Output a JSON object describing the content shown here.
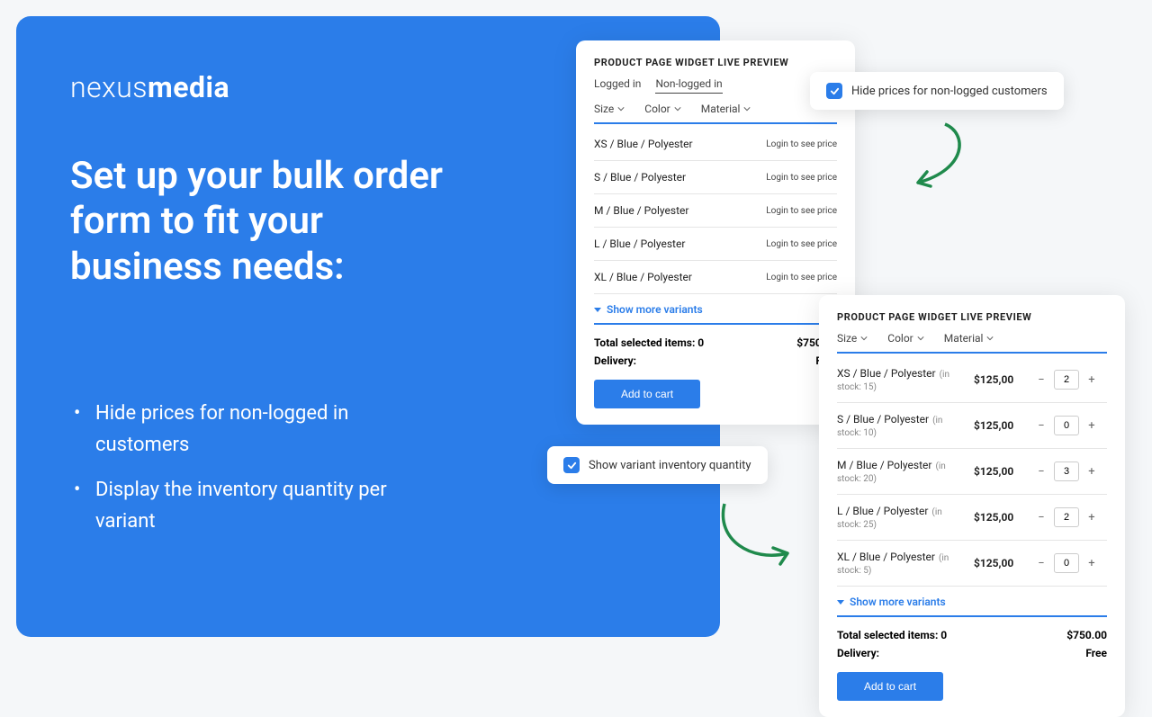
{
  "logo": {
    "part1": "nexus",
    "part2": "media"
  },
  "headline": "Set up your bulk order form to fit your business needs:",
  "bullets": [
    "Hide prices for non-logged in customers",
    "Display the inventory quantity per variant"
  ],
  "toggles": {
    "hide_prices": "Hide prices for non-logged customers",
    "show_inventory": "Show variant inventory quantity"
  },
  "widget_title": "PRODUCT PAGE WIDGET LIVE PREVIEW",
  "tabs": {
    "logged_in": "Logged in",
    "non_logged": "Non-logged in"
  },
  "filters": {
    "size": "Size",
    "color": "Color",
    "material": "Material"
  },
  "show_more": "Show  more variants",
  "login_msg": "Login to see price",
  "totals": {
    "items_label": "Total selected items: 0",
    "delivery_label": "Delivery:",
    "amount": "$750.00",
    "delivery_value": "Free"
  },
  "cart_btn": "Add to cart",
  "widget1_rows": [
    {
      "name": "XS / Blue / Polyester"
    },
    {
      "name": "S / Blue / Polyester"
    },
    {
      "name": "M / Blue / Polyester"
    },
    {
      "name": "L / Blue / Polyester"
    },
    {
      "name": "XL / Blue / Polyester"
    }
  ],
  "widget2_rows": [
    {
      "name": "XS / Blue / Polyester",
      "stock": "(in stock: 15)",
      "price": "$125,00",
      "qty": "2"
    },
    {
      "name": "S / Blue / Polyester",
      "stock": "(in stock: 10)",
      "price": "$125,00",
      "qty": "0"
    },
    {
      "name": "M / Blue / Polyester",
      "stock": "(in stock: 20)",
      "price": "$125,00",
      "qty": "3"
    },
    {
      "name": "L / Blue / Polyester",
      "stock": "(in stock: 25)",
      "price": "$125,00",
      "qty": "2"
    },
    {
      "name": "XL / Blue / Polyester",
      "stock": "(in stock: 5)",
      "price": "$125,00",
      "qty": "0"
    }
  ]
}
